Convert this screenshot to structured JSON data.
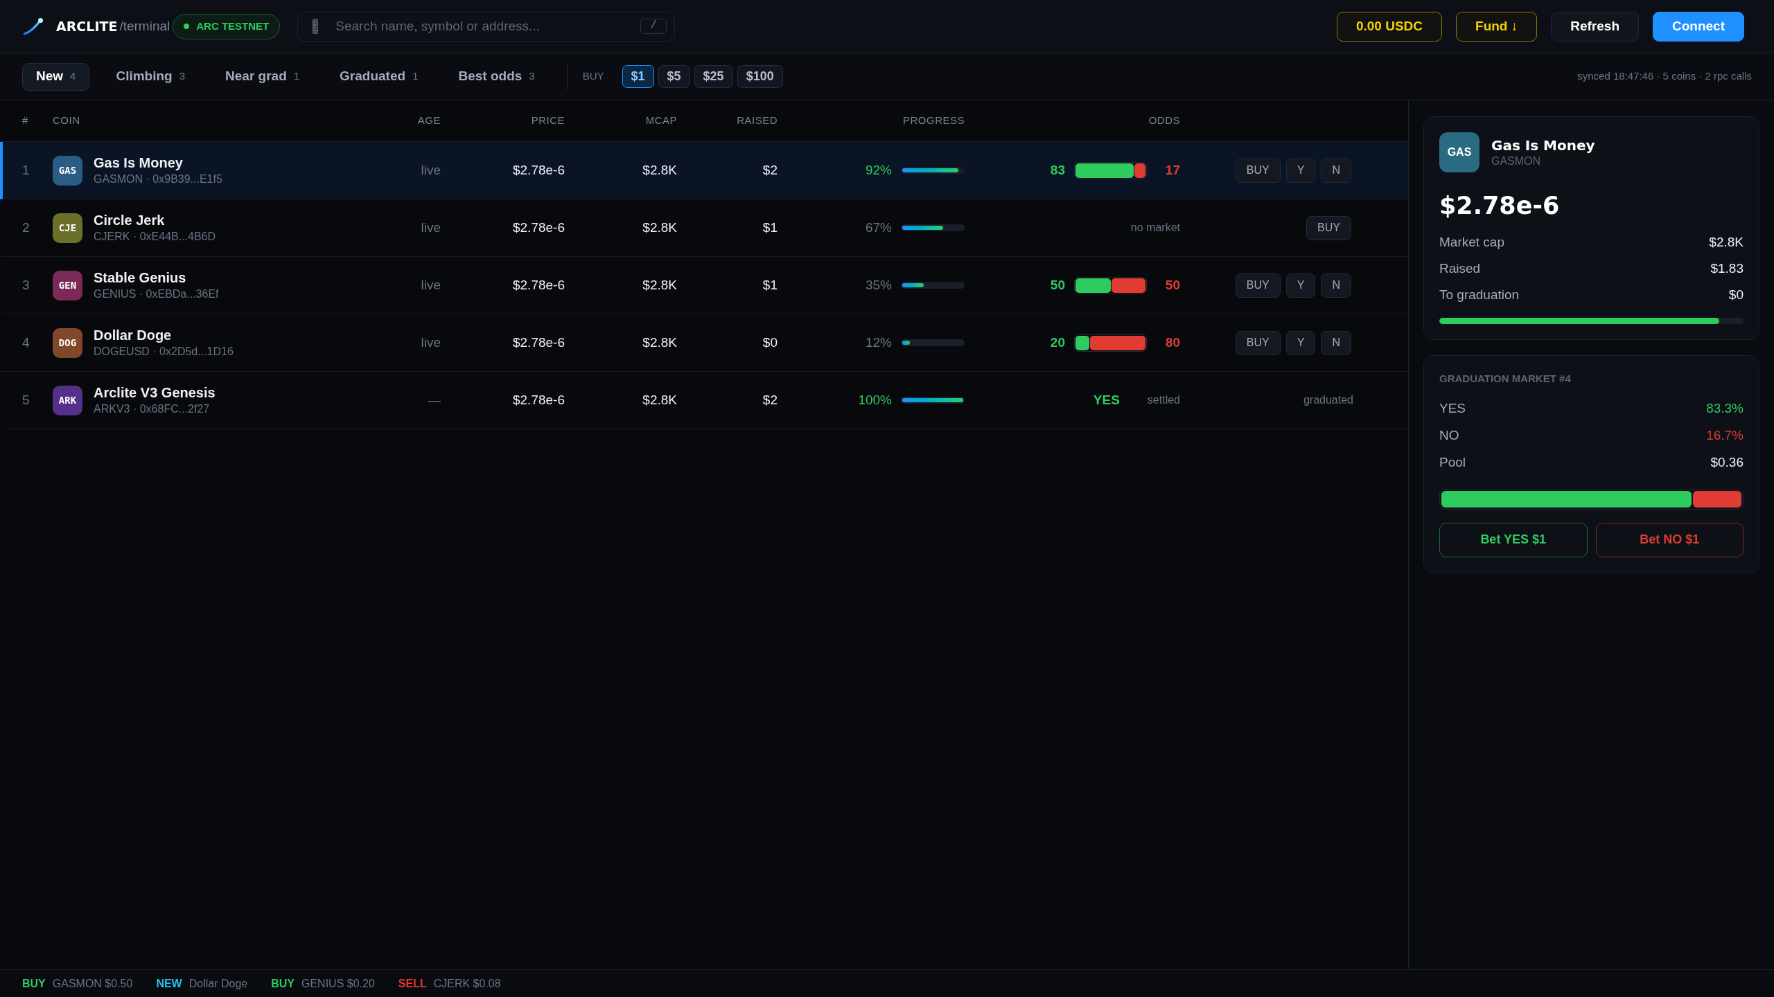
{
  "header": {
    "brand": "ARCLITE",
    "brand_suffix": "/terminal",
    "network_badge": "ARC TESTNET",
    "search": {
      "placeholder": "Search name, symbol or address...",
      "shortcut": "/"
    },
    "buttons": [
      {
        "label": "0.00 USDC",
        "kind": "accent"
      },
      {
        "label": "Fund ↓",
        "kind": "accent"
      },
      {
        "label": "Refresh",
        "kind": "plain"
      },
      {
        "label": "Connect",
        "kind": "primary"
      }
    ]
  },
  "tabs": [
    {
      "label": "New",
      "count": "4",
      "selected": true
    },
    {
      "label": "Climbing",
      "count": "3",
      "selected": false
    },
    {
      "label": "Near grad",
      "count": "1",
      "selected": false
    },
    {
      "label": "Graduated",
      "count": "1",
      "selected": false
    },
    {
      "label": "Best odds",
      "count": "3",
      "selected": false
    }
  ],
  "buy_amount": {
    "label": "BUY",
    "options": [
      {
        "label": "$1",
        "selected": true
      },
      {
        "label": "$5",
        "selected": false
      },
      {
        "label": "$25",
        "selected": false
      },
      {
        "label": "$100",
        "selected": false
      }
    ]
  },
  "sync_status": "synced 18:47:46 · 5 coins · 2 rpc calls",
  "table": {
    "columns": [
      "#",
      "COIN",
      "AGE",
      "PRICE",
      "MCAP",
      "RAISED",
      "PROGRESS",
      "ODDS"
    ],
    "rows": [
      {
        "rank": "1",
        "avatar": "GAS",
        "color": "#2b5c86",
        "name": "Gas Is Money",
        "meta": "GASMON · 0x9B39...E1f5",
        "age": "live",
        "price": "$2.78e-6",
        "mcap": "$2.8K",
        "raised": "$2",
        "progress": {
          "text": "92%",
          "level": 0.92
        },
        "odds": {
          "kind": "market",
          "yes": "83",
          "no": "17",
          "level": 0.83
        },
        "actions": {
          "kind": "buttons",
          "buttons": [
            "BUY",
            "Y",
            "N"
          ]
        },
        "selected": true
      },
      {
        "rank": "2",
        "avatar": "CJE",
        "color": "#6b6f29",
        "name": "Circle Jerk",
        "meta": "CJERK · 0xE44B...4B6D",
        "age": "live",
        "price": "$2.78e-6",
        "mcap": "$2.8K",
        "raised": "$1",
        "progress": {
          "text": "67%",
          "level": 0.67
        },
        "odds": {
          "kind": "none",
          "text": "no market"
        },
        "actions": {
          "kind": "buttons",
          "buttons": [
            "BUY"
          ]
        },
        "selected": false
      },
      {
        "rank": "3",
        "avatar": "GEN",
        "color": "#7b2a58",
        "name": "Stable Genius",
        "meta": "GENIUS · 0xEBDa...36Ef",
        "age": "live",
        "price": "$2.78e-6",
        "mcap": "$2.8K",
        "raised": "$1",
        "progress": {
          "text": "35%",
          "level": 0.35
        },
        "odds": {
          "kind": "market",
          "yes": "50",
          "no": "50",
          "level": 0.5
        },
        "actions": {
          "kind": "buttons",
          "buttons": [
            "BUY",
            "Y",
            "N"
          ]
        },
        "selected": false
      },
      {
        "rank": "4",
        "avatar": "DOG",
        "color": "#7f482a",
        "name": "Dollar Doge",
        "meta": "DOGEUSD · 0x2D5d...1D16",
        "age": "live",
        "price": "$2.78e-6",
        "mcap": "$2.8K",
        "raised": "$0",
        "progress": {
          "text": "12%",
          "level": 0.12
        },
        "odds": {
          "kind": "market",
          "yes": "20",
          "no": "80",
          "level": 0.2
        },
        "actions": {
          "kind": "buttons",
          "buttons": [
            "BUY",
            "Y",
            "N"
          ]
        },
        "selected": false
      },
      {
        "rank": "5",
        "avatar": "ARK",
        "color": "#55308a",
        "name": "Arclite V3 Genesis",
        "meta": "ARKV3 · 0x68FC...2f27",
        "age": "—",
        "price": "$2.78e-6",
        "mcap": "$2.8K",
        "raised": "$2",
        "progress": {
          "text": "100%",
          "level": 1.0
        },
        "odds": {
          "kind": "settled",
          "outcome": "YES",
          "text": "settled"
        },
        "actions": {
          "kind": "note",
          "text": "graduated"
        },
        "selected": false
      }
    ]
  },
  "detail": {
    "avatar": "GAS",
    "color": "#2a6a82",
    "name": "Gas Is Money",
    "symbol": "GASMON",
    "price": "$2.78e-6",
    "stats": [
      {
        "label": "Market cap",
        "value": "$2.8K"
      },
      {
        "label": "Raised",
        "value": "$1.83"
      },
      {
        "label": "To graduation",
        "value": "$0"
      }
    ],
    "progress": {
      "level": 0.92
    }
  },
  "market": {
    "title": "GRADUATION MARKET #4",
    "rows": [
      {
        "label": "YES",
        "value": "83.3%",
        "kind": "yes"
      },
      {
        "label": "NO",
        "value": "16.7%",
        "kind": "no"
      },
      {
        "label": "Pool",
        "value": "$0.36",
        "kind": "plain"
      }
    ],
    "level": 0.833,
    "buttons": [
      {
        "label": "Bet YES $1",
        "kind": "yes"
      },
      {
        "label": "Bet NO $1",
        "kind": "no"
      }
    ]
  },
  "ticker": [
    {
      "action": "BUY",
      "color": "#2ecc5f",
      "text": "GASMON $0.50"
    },
    {
      "action": "NEW",
      "color": "#22c3e6",
      "text": "Dollar Doge"
    },
    {
      "action": "BUY",
      "color": "#2ecc5f",
      "text": "GENIUS $0.20"
    },
    {
      "action": "SELL",
      "color": "#e23c32",
      "text": "CJERK $0.08"
    }
  ]
}
